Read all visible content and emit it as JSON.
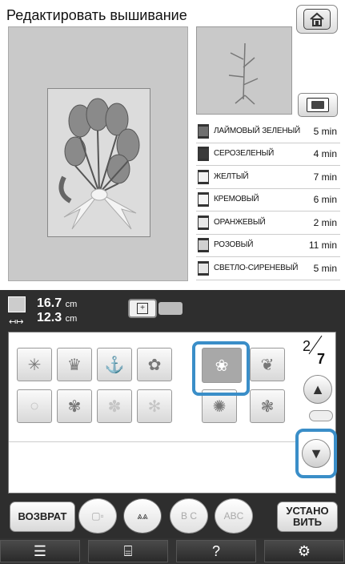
{
  "header": {
    "title": "Редактировать вышивание",
    "home_icon": "home-icon"
  },
  "frame_button_icon": "embroidery-frame-icon",
  "threads": [
    {
      "name": "ЛАЙМОВЫЙ ЗЕЛЕНЫЙ",
      "time": "5 min",
      "color": "#6f6f6f"
    },
    {
      "name": "СЕРОЗЕЛЕНЫЙ",
      "time": "4 min",
      "color": "#3a3a3a"
    },
    {
      "name": "ЖЕЛТЫЙ",
      "time": "7 min",
      "color": "#f2f2f2"
    },
    {
      "name": "КРЕМОВЫЙ",
      "time": "6 min",
      "color": "#f6f6f6"
    },
    {
      "name": "ОРАНЖЕВЫЙ",
      "time": "2 min",
      "color": "#e8e8e8"
    },
    {
      "name": "РОЗОВЫЙ",
      "time": "11 min",
      "color": "#d0d0d0"
    },
    {
      "name": "СВЕТЛО-СИРЕНЕВЫЙ",
      "time": "5 min",
      "color": "#e5e5e5"
    }
  ],
  "size": {
    "height_value": "16.7",
    "width_value": "12.3",
    "unit": "cm"
  },
  "pager": {
    "current": "2",
    "total": "7"
  },
  "buttons": {
    "back": "ВОЗВРАТ",
    "set": "УСТАНО ВИТЬ",
    "abc_label": "ABC",
    "bc_label": "B C"
  },
  "accent_color": "#3a8ec8",
  "bottom_bar_icons": [
    "document-icon",
    "sewing-machine-icon",
    "help-icon",
    "settings-icon"
  ],
  "bottom_help": "?"
}
